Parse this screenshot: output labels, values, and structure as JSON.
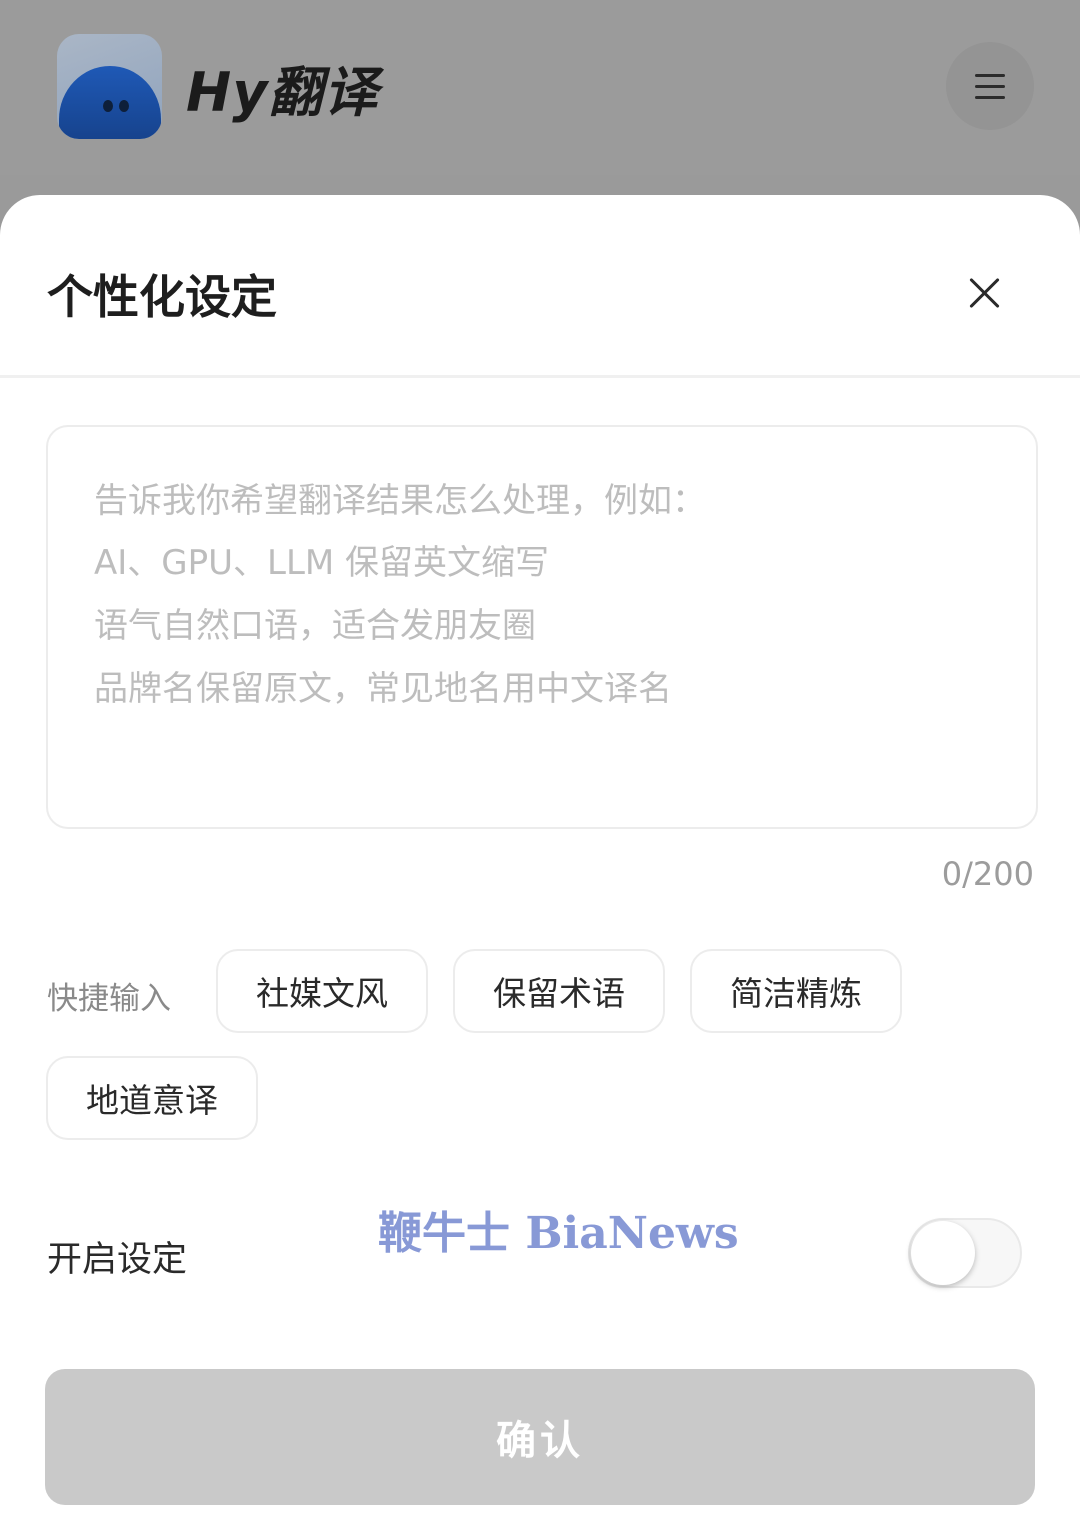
{
  "header": {
    "app_title": "Hy翻译",
    "logo_icon": "hy-mascot-logo-icon",
    "menu_icon": "hamburger-menu-icon"
  },
  "sheet": {
    "title": "个性化设定",
    "close_icon": "close-icon",
    "input": {
      "value": "",
      "placeholder_lines": [
        "告诉我你希望翻译结果怎么处理，例如：",
        "AI、GPU、LLM 保留英文缩写",
        "语气自然口语，适合发朋友圈",
        "品牌名保留原文，常见地名用中文译名"
      ],
      "counter": "0/200"
    },
    "quick_input": {
      "label": "快捷输入",
      "chips": [
        "社媒文风",
        "保留术语",
        "简洁精炼",
        "地道意译"
      ]
    },
    "toggle": {
      "label": "开启设定",
      "state": "off"
    },
    "confirm_label": "确认",
    "watermark": "鞭牛士 BiaNews"
  },
  "colors": {
    "overlay": "#9a9a9a",
    "sheet_background": "#ffffff",
    "confirm_disabled": "#c9c9c9",
    "watermark": "#7c8fd2",
    "logo_blue": "#1f59b6"
  }
}
